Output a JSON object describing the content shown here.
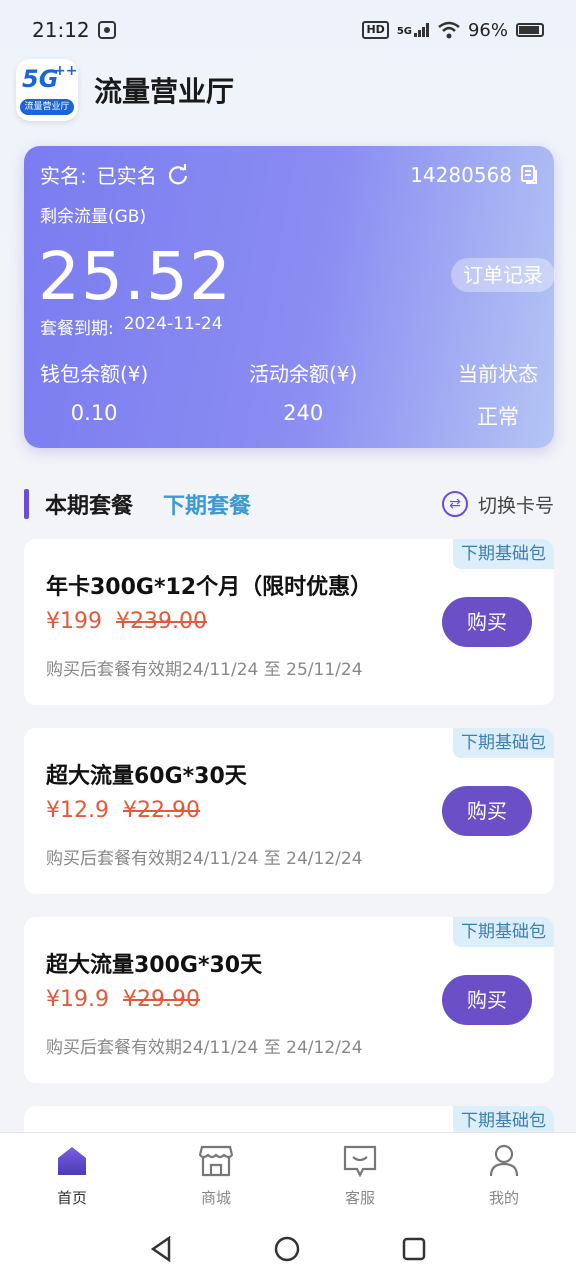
{
  "status_bar": {
    "time": "21:12",
    "signal": "5G",
    "battery": "96%"
  },
  "app": {
    "title": "流量营业厅",
    "logo_text": "5G",
    "logo_sub": "流量营业厅"
  },
  "card": {
    "real_name_label": "实名:",
    "real_name_value": "已实名",
    "phone": "14280568",
    "remain_label": "剩余流量(GB)",
    "remain_value": "25.52",
    "order_btn": "订单记录",
    "expire_label": "套餐到期:",
    "expire_value": "2024-11-24",
    "stats": [
      {
        "label": "钱包余额(¥)",
        "value": "0.10"
      },
      {
        "label": "活动余额(¥)",
        "value": "240"
      },
      {
        "label": "当前状态",
        "value": "正常"
      }
    ]
  },
  "tabs": {
    "current": "本期套餐",
    "next": "下期套餐",
    "switch": "切换卡号"
  },
  "packages": [
    {
      "tag": "下期基础包",
      "name": "年卡300G*12个月（限时优惠）",
      "price": "¥199",
      "old_price": "¥239.00",
      "valid": "购买后套餐有效期24/11/24 至 25/11/24",
      "buy": "购买"
    },
    {
      "tag": "下期基础包",
      "name": "超大流量60G*30天",
      "price": "¥12.9",
      "old_price": "¥22.90",
      "valid": "购买后套餐有效期24/11/24 至 24/12/24",
      "buy": "购买"
    },
    {
      "tag": "下期基础包",
      "name": "超大流量300G*30天",
      "price": "¥19.9",
      "old_price": "¥29.90",
      "valid": "购买后套餐有效期24/11/24 至 24/12/24",
      "buy": "购买"
    },
    {
      "tag": "下期基础包"
    }
  ],
  "nav": [
    {
      "label": "首页",
      "icon": "home-icon"
    },
    {
      "label": "商城",
      "icon": "store-icon"
    },
    {
      "label": "客服",
      "icon": "message-icon"
    },
    {
      "label": "我的",
      "icon": "user-icon"
    }
  ],
  "colors": {
    "accent": "#6a4fc7",
    "price": "#e35a3a",
    "tag_bg": "#dceefa"
  }
}
